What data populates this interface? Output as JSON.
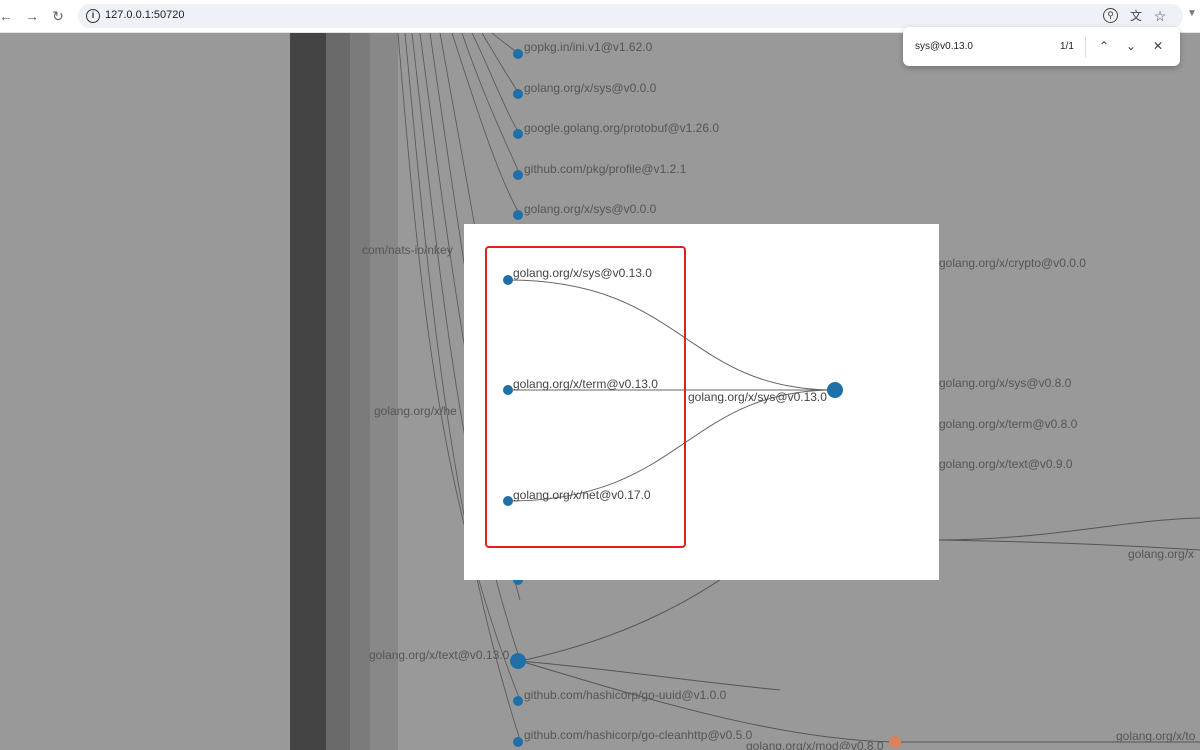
{
  "browser": {
    "url": "127.0.0.1:50720",
    "icons": [
      "back-icon",
      "forward-icon",
      "reload-icon",
      "site-info-icon",
      "search-page-icon",
      "translate-icon",
      "bookmark-star-icon",
      "extension-dropdown-icon"
    ]
  },
  "find_bar": {
    "query": "sys@v0.13.0",
    "count": "1/1"
  },
  "graph": {
    "nodes": [
      "gopkg.in/ini.v1@v1.62.0",
      "golang.org/x/sys@v0.0.0",
      "google.golang.org/protobuf@v1.26.0",
      "github.com/pkg/profile@v1.2.1",
      "golang.org/x/sys@v0.0.0",
      "com/nats-io/nkey",
      "golang.org/x/crypto@v0.0.0",
      "golang.org/x/sys@v0.8.0",
      "golang.org/x/term@v0.8.0",
      "golang.org/x/text@v0.9.0",
      "golang.org/x/he",
      "golang.org/x",
      "golang.org/x/text@v0.13.0",
      "github.com/hashicorp/go-uuid@v1.0.0",
      "github.com/hashicorp/go-cleanhttp@v0.5.0",
      "golang.org/x/mod@v0.8.0",
      "golang.org/x/to"
    ]
  },
  "popup": {
    "sources": [
      "golang.org/x/sys@v0.13.0",
      "golang.org/x/term@v0.13.0",
      "golang.org/x/net@v0.17.0"
    ],
    "target": "golang.org/x/sys@v0.13.0"
  },
  "colors": {
    "node_blue": "#1f6fa8",
    "node_orange": "#d9825b",
    "highlight_red": "#e02020",
    "graph_background": "#999999"
  }
}
